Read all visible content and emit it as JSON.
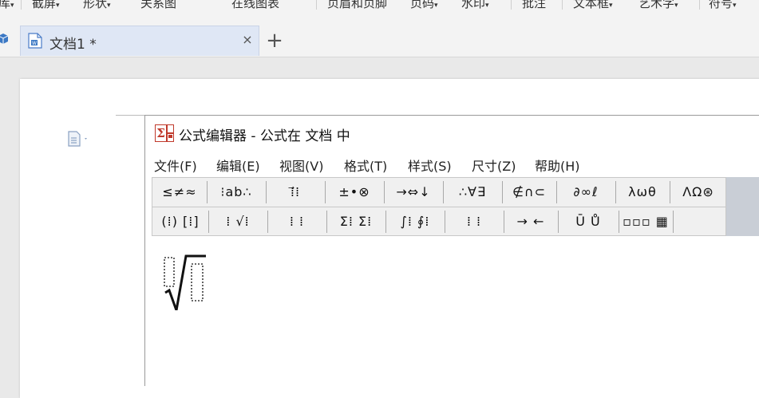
{
  "ribbon": {
    "items": [
      {
        "label": "库",
        "arrow": "▾"
      },
      {
        "label": "截屏",
        "arrow": "▾"
      },
      {
        "label": "形状",
        "arrow": "▾"
      },
      {
        "label": "关系图",
        "arrow": ""
      },
      {
        "label": "在线图表",
        "arrow": ""
      },
      {
        "label": "页眉和页脚",
        "arrow": ""
      },
      {
        "label": "页码",
        "arrow": "▾"
      },
      {
        "label": "水印",
        "arrow": "▾"
      },
      {
        "label": "批注",
        "arrow": ""
      },
      {
        "label": "文本框",
        "arrow": "▾"
      },
      {
        "label": "艺术字",
        "arrow": "▾"
      },
      {
        "label": "符号",
        "arrow": "▾"
      }
    ]
  },
  "tabs": {
    "active_title": "文档1 *",
    "close_glyph": "×",
    "add_glyph": "+"
  },
  "colors": {
    "accent": "#3b78c4",
    "tab_bg": "#dfe7f5",
    "window_border": "#9a9a9a",
    "palette_bg": "#f0f0f0"
  },
  "equation_editor": {
    "title": "公式编辑器 - 公式在 文档 中",
    "menu": [
      "文件(F)",
      "编辑(E)",
      "视图(V)",
      "格式(T)",
      "样式(S)",
      "尺寸(Z)",
      "帮助(H)"
    ],
    "palette_row1": [
      "≤≠≈",
      "⁝ab∴",
      "⁞⃗⁞",
      "±•⊗",
      "→⇔↓",
      "∴∀∃",
      "∉∩⊂",
      "∂∞ℓ",
      "λωθ",
      "ΛΩ⊛"
    ],
    "palette_row2": [
      "(⁞) [⁞]",
      "⁞ √⁞",
      "⁞ ⁞",
      "Σ⁞ Σ⁞",
      "∫⁞ ∮⁞",
      "⁞ ⁞",
      "→ ←",
      "Ū Ů",
      "▫▫▫ ▦"
    ]
  },
  "icons": [
    "cube-icon",
    "document-icon",
    "close-icon",
    "add-icon",
    "paragraph-icon",
    "sigma-icon",
    "sqrt-template-icon"
  ]
}
